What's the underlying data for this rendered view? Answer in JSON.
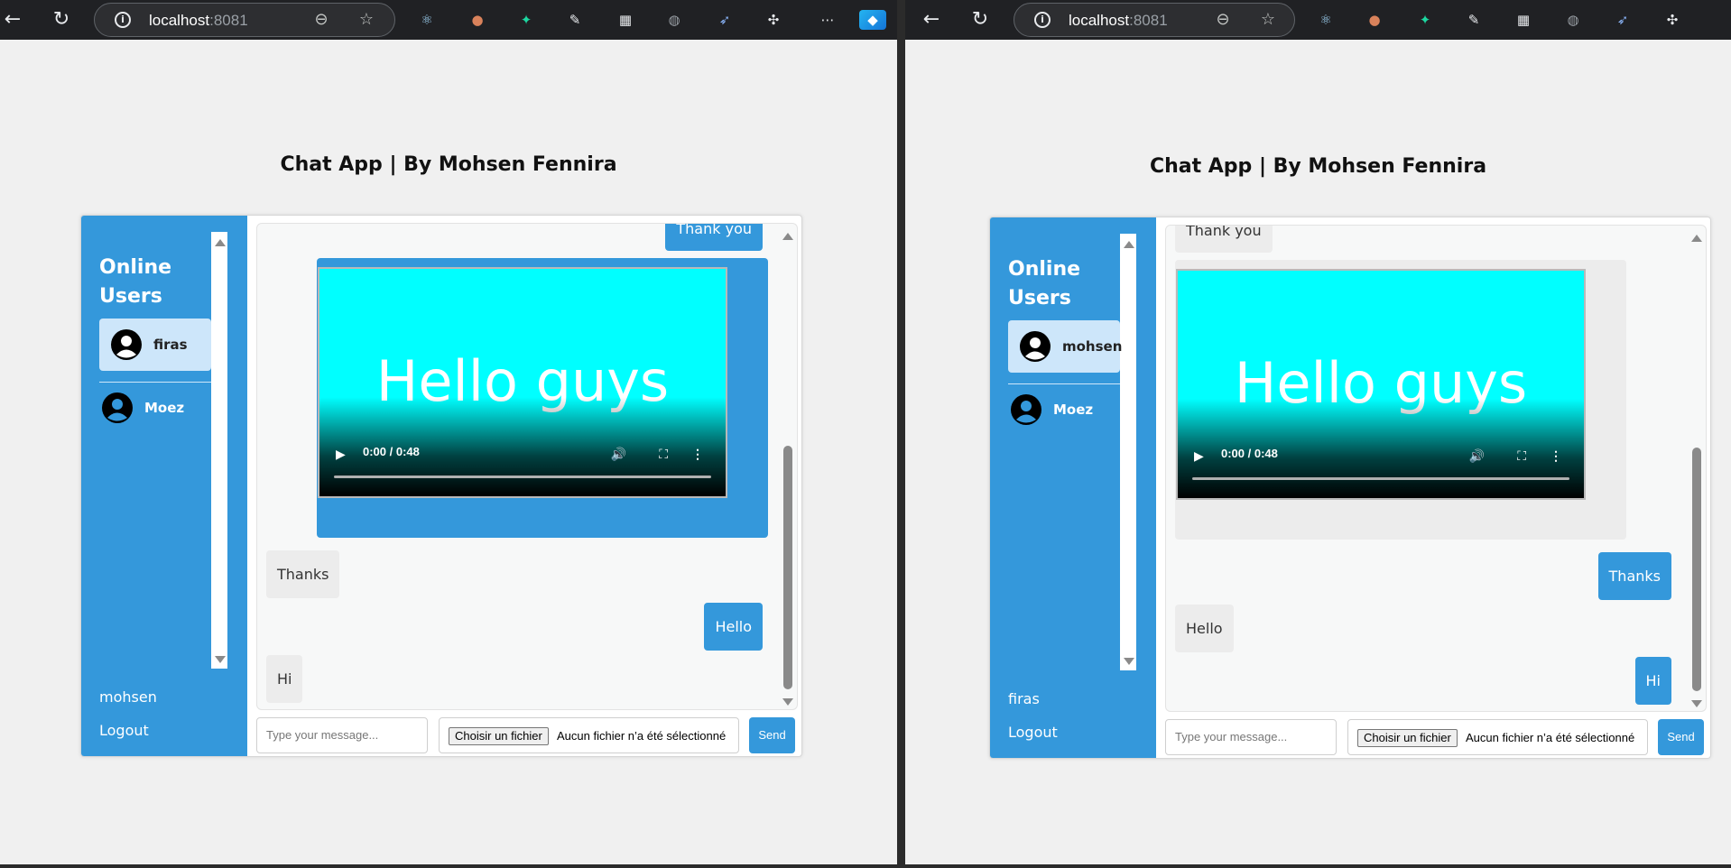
{
  "browser": {
    "url_host": "localhost",
    "url_port": ":8081"
  },
  "left_window": {
    "title": "Chat App | By Mohsen Fennira",
    "sidebar": {
      "heading": "Online Users",
      "users": [
        {
          "name": "firas",
          "active": true
        },
        {
          "name": "Moez",
          "active": false
        }
      ],
      "current_user": "mohsen",
      "logout_label": "Logout"
    },
    "messages": [
      {
        "type": "text",
        "direction": "sent",
        "text": "Thank you"
      },
      {
        "type": "video",
        "direction": "sent",
        "video_text": "Hello guys",
        "time": "0:00 / 0:48"
      },
      {
        "type": "text",
        "direction": "received",
        "text": "Thanks"
      },
      {
        "type": "text",
        "direction": "sent",
        "text": "Hello"
      },
      {
        "type": "text",
        "direction": "received",
        "text": "Hi"
      }
    ],
    "input": {
      "placeholder": "Type your message...",
      "file_button": "Choisir un fichier",
      "file_status": "Aucun fichier n’a été sélectionné",
      "send_label": "Send"
    }
  },
  "right_window": {
    "title": "Chat App | By Mohsen Fennira",
    "sidebar": {
      "heading": "Online Users",
      "users": [
        {
          "name": "mohsen",
          "active": true
        },
        {
          "name": "Moez",
          "active": false
        }
      ],
      "current_user": "firas",
      "logout_label": "Logout"
    },
    "messages": [
      {
        "type": "text",
        "direction": "received",
        "text": "Thank you"
      },
      {
        "type": "video",
        "direction": "received",
        "video_text": "Hello guys",
        "time": "0:00 / 0:48"
      },
      {
        "type": "text",
        "direction": "sent",
        "text": "Thanks"
      },
      {
        "type": "text",
        "direction": "received",
        "text": "Hello"
      },
      {
        "type": "text",
        "direction": "sent",
        "text": "Hi"
      }
    ],
    "input": {
      "placeholder": "Type your message...",
      "file_button": "Choisir un fichier",
      "file_status": "Aucun fichier n’a été sélectionné",
      "send_label": "Send"
    }
  },
  "colors": {
    "accent": "#3498db",
    "active_user_bg": "#cde6fa",
    "received_bubble": "#ececec",
    "video_bg": "#00ffff",
    "page_bg": "#f0f0f0"
  },
  "icons": {
    "back": "back-arrow-icon",
    "reload": "reload-icon",
    "info": "site-info-icon",
    "zoom": "zoom-out-icon",
    "favorite": "star-icon",
    "extensions": "puzzle-icon",
    "more": "more-icon",
    "avatar": "user-avatar-icon"
  }
}
